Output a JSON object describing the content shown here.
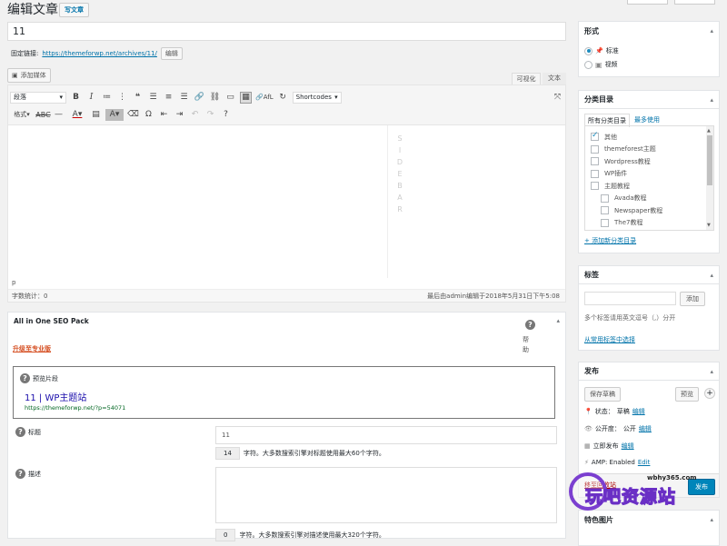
{
  "header": {
    "title": "编辑文章",
    "add_new": "写文章"
  },
  "post": {
    "title": "11",
    "permalink_label": "固定链接:",
    "permalink_url": "https://themeforwp.net/archives/11/",
    "edit_btn": "编辑"
  },
  "editor": {
    "add_media": "添加媒体",
    "tab_visual": "可视化",
    "tab_text": "文本",
    "format_select": "段落",
    "shortcodes": "Shortcodes",
    "format_label": "格式",
    "afl": "AfL",
    "sidebar_letters": [
      "S",
      "I",
      "D",
      "E",
      "B",
      "A",
      "R"
    ],
    "path": "p",
    "word_count": "字数统计：0",
    "last_edited": "最后由admin编辑于2018年5月31日下午5:08"
  },
  "seo": {
    "title": "All in One SEO Pack",
    "upgrade": "升级至专业版",
    "help": "帮助",
    "preview_label": "预览片段",
    "preview_title": "11 | WP主题站",
    "preview_url": "https://themeforwp.net/?p=54071",
    "title_label": "标题",
    "title_value": "11",
    "count_title": "14",
    "count_title_text": "字符。大多数搜索引擎对标题使用最大60个字符。",
    "desc_label": "描述",
    "count_desc": "0",
    "count_desc_text": "字符。大多数搜索引擎对描述使用最大320个字符。"
  },
  "format_box": {
    "title": "形式",
    "opt1": "标准",
    "opt2": "视频"
  },
  "category_box": {
    "title": "分类目录",
    "tab_all": "所有分类目录",
    "tab_used": "最多使用",
    "items": [
      {
        "label": "其他",
        "checked": true,
        "indent": false
      },
      {
        "label": "themeforest主题",
        "checked": false,
        "indent": false
      },
      {
        "label": "Wordpress教程",
        "checked": false,
        "indent": false
      },
      {
        "label": "WP插件",
        "checked": false,
        "indent": false
      },
      {
        "label": "主题教程",
        "checked": false,
        "indent": false
      },
      {
        "label": "Avada教程",
        "checked": false,
        "indent": true
      },
      {
        "label": "Newspaper教程",
        "checked": false,
        "indent": true
      },
      {
        "label": "The7教程",
        "checked": false,
        "indent": true
      }
    ],
    "add_new": "+ 添加新分类目录"
  },
  "tags_box": {
    "title": "标签",
    "add_btn": "添加",
    "hint": "多个标签请用英文逗号（,）分开",
    "choose": "从常用标签中选择"
  },
  "publish_box": {
    "title": "发布",
    "save_draft": "保存草稿",
    "preview": "预览",
    "status_label": "状态：",
    "status_value": "草稿",
    "status_edit": "编辑",
    "visibility_label": "公开度：",
    "visibility_value": "公开",
    "visibility_edit": "编辑",
    "publish_label": "立即发布",
    "publish_edit": "编辑",
    "amp_label": "AMP: Enabled",
    "amp_edit": "Edit",
    "trash": "移至回收站",
    "publish_btn": "发布"
  },
  "featured_box": {
    "title": "特色图片"
  },
  "watermark": {
    "site": "wbhy365.com",
    "text": "玩吧资源站"
  }
}
